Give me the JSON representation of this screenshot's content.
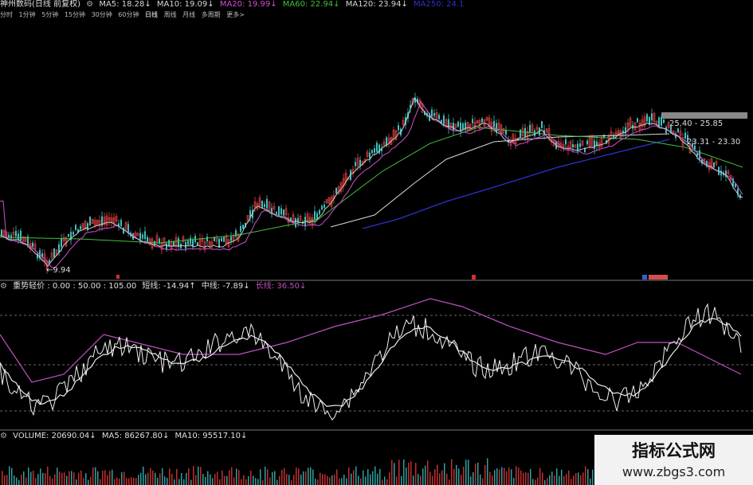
{
  "header": {
    "stock": "神州数码(日线 前复权)",
    "ma_items": [
      {
        "label": "MA5: 18.28↓",
        "color": "#d8d8d8"
      },
      {
        "label": "MA10: 19.09↓",
        "color": "#d8d8d8"
      },
      {
        "label": "MA20: 19.99↓",
        "color": "#d050d0"
      },
      {
        "label": "MA60: 22.94↓",
        "color": "#40c040"
      },
      {
        "label": "MA120: 23.94↓",
        "color": "#d8d8d8"
      },
      {
        "label": "MA250: 24.1",
        "color": "#3030d0"
      }
    ]
  },
  "timeframes": [
    "分时",
    "1分钟",
    "5分钟",
    "15分钟",
    "30分钟",
    "60分钟",
    "日线",
    "周线",
    "月线",
    "多周期",
    "更多>"
  ],
  "active_timeframe": "日线",
  "price_labels": {
    "low": "9.94",
    "range1": "25.40 - 25.85",
    "range2": "23.31 - 23.30"
  },
  "indicator": {
    "name": "重势轻价 : 0.00 : 50.00 : 105.00",
    "short": "短线: -14.94↑",
    "mid": "中线: -7.89↓",
    "long": "长线: 36.50↓",
    "long_color": "#c050c0"
  },
  "volume": {
    "vol": "VOLUME: 20690.04↓",
    "ma5": "MA5: 86267.80↓",
    "ma10": "MA10: 95517.10↓"
  },
  "watermark": {
    "title": "指标公式网",
    "url": "www.zbgs3.com"
  }
}
